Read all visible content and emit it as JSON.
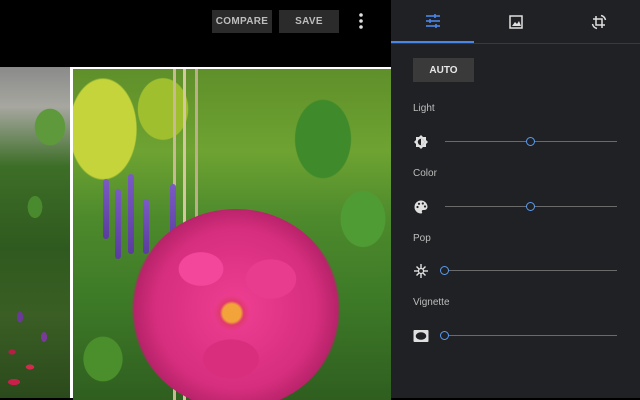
{
  "toolbar": {
    "compare_label": "COMPARE",
    "save_label": "SAVE",
    "more_icon": "more-vert-icon"
  },
  "panel": {
    "tabs": [
      {
        "name": "basic-adjustments",
        "icon": "tune-icon",
        "active": true
      },
      {
        "name": "filters",
        "icon": "photo-filter-icon",
        "active": false
      },
      {
        "name": "crop-rotate",
        "icon": "crop-rotate-icon",
        "active": false
      }
    ],
    "auto_label": "AUTO",
    "sliders": [
      {
        "label": "Light",
        "icon": "brightness-icon",
        "value": 0.5
      },
      {
        "label": "Color",
        "icon": "palette-icon",
        "value": 0.5
      },
      {
        "label": "Pop",
        "icon": "sparkle-icon",
        "value": 0.0
      },
      {
        "label": "Vignette",
        "icon": "vignette-icon",
        "value": 0.0
      }
    ]
  },
  "colors": {
    "accent": "#4a86e8",
    "panel_bg": "#202124",
    "button_bg": "#2b2b2b"
  }
}
